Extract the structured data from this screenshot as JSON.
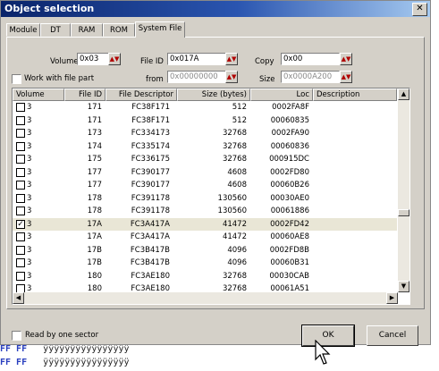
{
  "window": {
    "title": "Object selection",
    "close_glyph": "✕"
  },
  "tabs": [
    "Module",
    "DT",
    "RAM",
    "ROM",
    "System File"
  ],
  "active_tab": "System File",
  "controls": {
    "volume_label": "Volume",
    "volume_value": "0x03",
    "fileid_label": "File ID",
    "fileid_value": "0x017A",
    "copy_label": "Copy",
    "copy_value": "0x00",
    "from_label": "from",
    "from_value": "0x00000000",
    "size_label": "Size",
    "size_value": "0x0000A200",
    "work_with_file_part": "Work with file part",
    "spin_glyph": "▲▼"
  },
  "table": {
    "columns": [
      "Volume",
      "File ID",
      "File Descriptor",
      "Size (bytes)",
      "Loc",
      "Description"
    ],
    "rows": [
      {
        "checked": false,
        "volume": "3",
        "file_id": "171",
        "descriptor": "FC38F171",
        "size": "512",
        "loc": "0002FA8F",
        "selected": false
      },
      {
        "checked": false,
        "volume": "3",
        "file_id": "171",
        "descriptor": "FC38F171",
        "size": "512",
        "loc": "00060835",
        "selected": false
      },
      {
        "checked": false,
        "volume": "3",
        "file_id": "173",
        "descriptor": "FC334173",
        "size": "32768",
        "loc": "0002FA90",
        "selected": false
      },
      {
        "checked": false,
        "volume": "3",
        "file_id": "174",
        "descriptor": "FC335174",
        "size": "32768",
        "loc": "00060836",
        "selected": false
      },
      {
        "checked": false,
        "volume": "3",
        "file_id": "175",
        "descriptor": "FC336175",
        "size": "32768",
        "loc": "000915DC",
        "selected": false
      },
      {
        "checked": false,
        "volume": "3",
        "file_id": "177",
        "descriptor": "FC390177",
        "size": "4608",
        "loc": "0002FD80",
        "selected": false
      },
      {
        "checked": false,
        "volume": "3",
        "file_id": "177",
        "descriptor": "FC390177",
        "size": "4608",
        "loc": "00060B26",
        "selected": false
      },
      {
        "checked": false,
        "volume": "3",
        "file_id": "178",
        "descriptor": "FC391178",
        "size": "130560",
        "loc": "00030AE0",
        "selected": false
      },
      {
        "checked": false,
        "volume": "3",
        "file_id": "178",
        "descriptor": "FC391178",
        "size": "130560",
        "loc": "00061886",
        "selected": false
      },
      {
        "checked": true,
        "volume": "3",
        "file_id": "17A",
        "descriptor": "FC3A417A",
        "size": "41472",
        "loc": "0002FD42",
        "selected": true
      },
      {
        "checked": false,
        "volume": "3",
        "file_id": "17A",
        "descriptor": "FC3A417A",
        "size": "41472",
        "loc": "00060AE8",
        "selected": false
      },
      {
        "checked": false,
        "volume": "3",
        "file_id": "17B",
        "descriptor": "FC3B417B",
        "size": "4096",
        "loc": "0002FD8B",
        "selected": false
      },
      {
        "checked": false,
        "volume": "3",
        "file_id": "17B",
        "descriptor": "FC3B417B",
        "size": "4096",
        "loc": "00060B31",
        "selected": false
      },
      {
        "checked": false,
        "volume": "3",
        "file_id": "180",
        "descriptor": "FC3AE180",
        "size": "32768",
        "loc": "00030CAB",
        "selected": false
      },
      {
        "checked": false,
        "volume": "3",
        "file_id": "180",
        "descriptor": "FC3AE180",
        "size": "32768",
        "loc": "00061A51",
        "selected": false
      }
    ]
  },
  "scroll_glyphs": {
    "up": "▲",
    "down": "▼",
    "left": "◀",
    "right": "▶"
  },
  "read_by_one_sector": "Read by one sector",
  "buttons": {
    "ok": "OK",
    "cancel": "Cancel"
  },
  "background_lines": [
    {
      "prefix": "FF FF",
      "text": "ÿÿÿÿÿÿÿÿÿÿÿÿÿÿÿÿ"
    },
    {
      "prefix": "FF FF",
      "text": "ÿÿÿÿÿÿÿÿÿÿÿÿÿÿÿÿ"
    }
  ]
}
